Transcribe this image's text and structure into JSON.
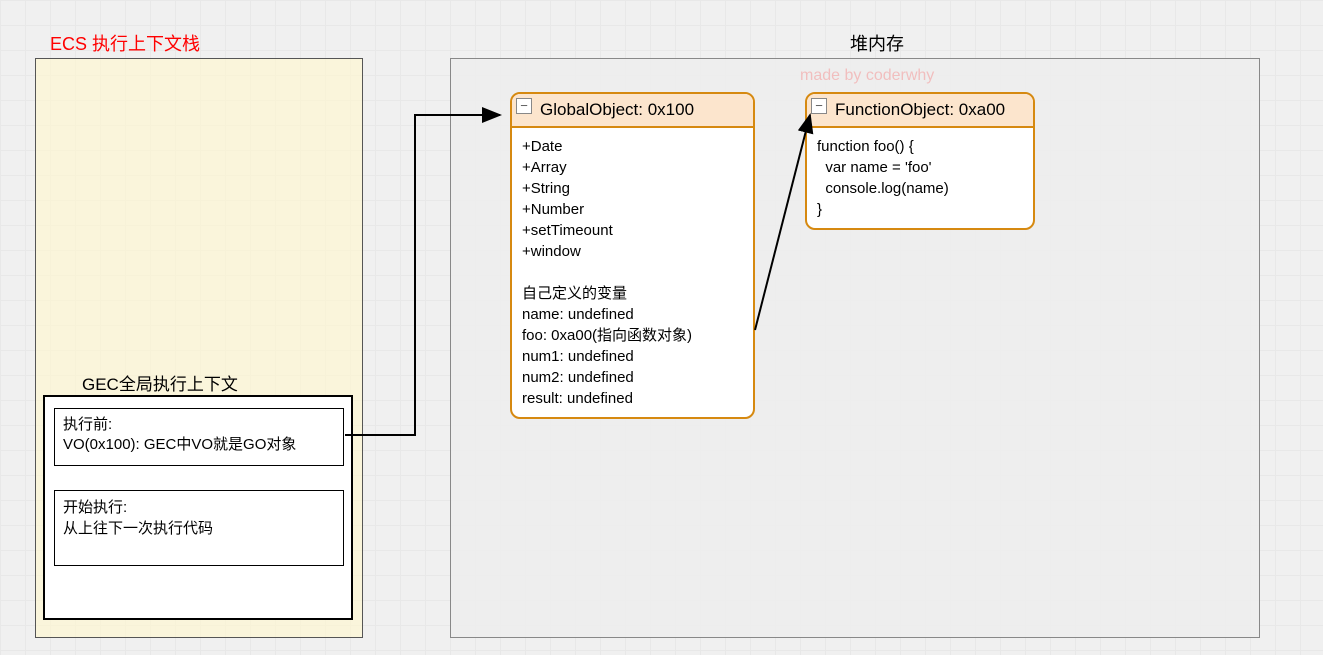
{
  "labels": {
    "ecs_title": "ECS 执行上下文栈",
    "heap_title": "堆内存",
    "author": "made by coderwhy",
    "gec_title": "GEC全局执行上下文"
  },
  "gec": {
    "before_label": "执行前:",
    "before_body": "VO(0x100): GEC中VO就是GO对象",
    "start_label": "开始执行:",
    "start_body": "从上往下一次执行代码"
  },
  "global_object": {
    "title": "GlobalObject: 0x100",
    "body": "+Date\n+Array\n+String\n+Number\n+setTimeount\n+window\n\n自己定义的变量\nname: undefined\nfoo: 0xa00(指向函数对象)\nnum1: undefined\nnum2: undefined\nresult: undefined"
  },
  "function_object": {
    "title": "FunctionObject: 0xa00",
    "body": "function foo() {\n  var name = 'foo'\n  console.log(name)\n}"
  }
}
